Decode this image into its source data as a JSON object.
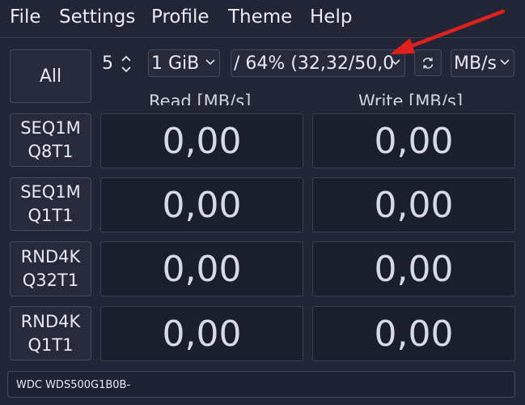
{
  "menu": [
    "File",
    "Settings",
    "Profile",
    "Theme",
    "Help"
  ],
  "toolbar": {
    "all_label": "All",
    "count_value": "5",
    "size_value": "1 GiB",
    "drive_value": "/ 64% (32,32/50,0",
    "unit_value": "MB/s"
  },
  "columns": {
    "read": "Read [MB/s]",
    "write": "Write [MB/s]"
  },
  "tests": [
    {
      "label_1": "SEQ1M",
      "label_2": "Q8T1",
      "read": "0,00",
      "write": "0,00"
    },
    {
      "label_1": "SEQ1M",
      "label_2": "Q1T1",
      "read": "0,00",
      "write": "0,00"
    },
    {
      "label_1": "RND4K",
      "label_2": "Q32T1",
      "read": "0,00",
      "write": "0,00"
    },
    {
      "label_1": "RND4K",
      "label_2": "Q1T1",
      "read": "0,00",
      "write": "0,00"
    }
  ],
  "status_text": "WDC WDS500G1B0B-",
  "colors": {
    "background": "#222536",
    "annotation_arrow": "#e0201c"
  }
}
